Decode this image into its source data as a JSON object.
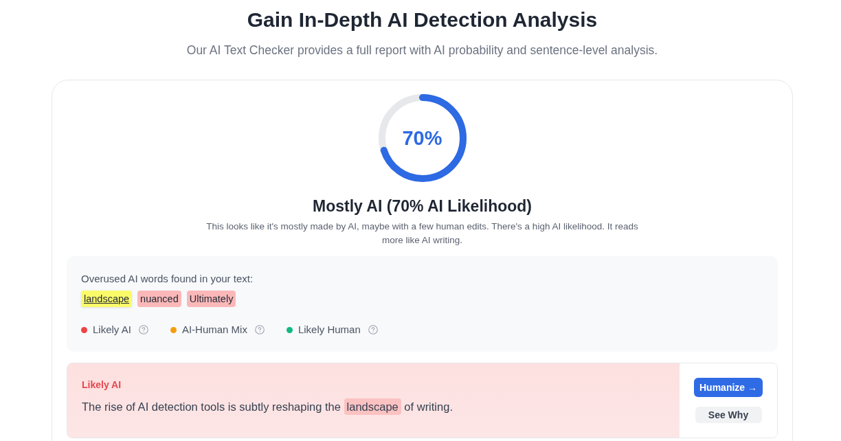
{
  "header": {
    "title": "Gain In-Depth AI Detection Analysis",
    "subtitle": "Our AI Text Checker provides a full report with AI probability and sentence-level analysis."
  },
  "report": {
    "score": {
      "label": "70%",
      "level": 0.7
    },
    "verdict": "Mostly AI (70% AI Likelihood)",
    "description": "This looks like it's mostly made by AI, maybe with a few human edits. There's a high AI likelihood. It reads more like AI writing.",
    "overused_words": {
      "label": "Overused AI words found in your text:",
      "words": [
        {
          "text": "landscape",
          "selected": true
        },
        {
          "text": "nuanced",
          "selected": false
        },
        {
          "text": "Ultimately",
          "selected": false
        }
      ]
    },
    "legend": [
      {
        "label": "Likely AI",
        "color": "#ef4444"
      },
      {
        "label": "AI-Human Mix",
        "color": "#f59e0b"
      },
      {
        "label": "Likely Human",
        "color": "#10b981"
      }
    ],
    "sentences": [
      {
        "kind": "ai",
        "category": "Likely AI",
        "parts": [
          {
            "text": "The rise of AI detection tools is subtly reshaping the ",
            "highlighted": false
          },
          {
            "text": "landscape",
            "highlighted": true
          },
          {
            "text": " of writing.",
            "highlighted": false
          }
        ],
        "actions": [
          {
            "label": "Humanize →",
            "kind": "primary"
          },
          {
            "label": "See Why",
            "kind": "secondary"
          }
        ]
      }
    ]
  }
}
